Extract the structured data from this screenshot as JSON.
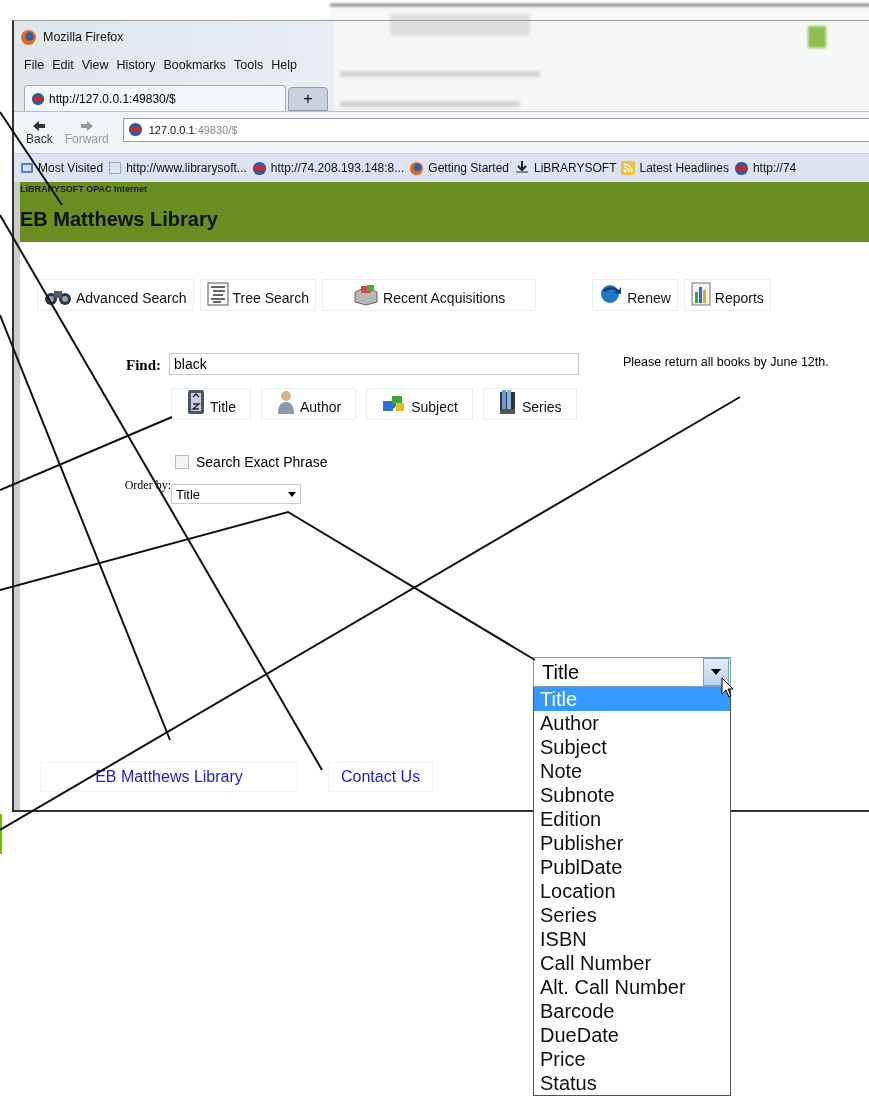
{
  "window": {
    "title": "Mozilla Firefox"
  },
  "menu_bar": [
    "File",
    "Edit",
    "View",
    "History",
    "Bookmarks",
    "Tools",
    "Help"
  ],
  "tabs": [
    {
      "label": "http://127.0.0.1:49830/$",
      "selected": true
    }
  ],
  "new_tab": "+",
  "navigation": {
    "back": {
      "label": "Back",
      "disabled": false
    },
    "forward": {
      "label": "Forward",
      "disabled": true
    },
    "address_host": "127.0.0.1",
    "address_rest": ":49830/$"
  },
  "bookmarks": [
    {
      "label": "Most Visited",
      "kind": "folder"
    },
    {
      "label": "http://www.librarysoft...",
      "kind": "page"
    },
    {
      "label": "http://74.208.193.148:8...",
      "kind": "site"
    },
    {
      "label": "Getting Started",
      "kind": "firefox"
    },
    {
      "label": "LiBRARYSOFT",
      "kind": "app"
    },
    {
      "label": "Latest Headlines",
      "kind": "feed"
    },
    {
      "label": "http://74",
      "kind": "site"
    }
  ],
  "page": {
    "brand": "LiBRARYSOFT OPAC Internet",
    "title": "EB Matthews Library",
    "nav_buttons": [
      {
        "label": "Advanced Search",
        "kind": "binoculars"
      },
      {
        "label": "Tree Search",
        "kind": "tree"
      },
      {
        "label": "Recent Acquisitions",
        "kind": "box"
      },
      {
        "label": "Renew",
        "kind": "renew"
      },
      {
        "label": "Reports",
        "kind": "chart"
      }
    ],
    "find": {
      "label": "Find:",
      "value": "black"
    },
    "notice": "Please return all books by June 12th.",
    "search_buttons": [
      {
        "label": "Title",
        "kind": "az"
      },
      {
        "label": "Author",
        "kind": "person"
      },
      {
        "label": "Subject",
        "kind": "puzzle"
      },
      {
        "label": "Series",
        "kind": "books"
      }
    ],
    "exact_phrase": {
      "label": "Search Exact Phrase",
      "checked": false
    },
    "order_by": {
      "label": "Order by:",
      "value": "Title"
    },
    "footer_links": [
      "EB Matthews Library",
      "Contact Us"
    ]
  },
  "order_dropdown": {
    "value": "Title",
    "options": [
      {
        "label": "Title",
        "selected": true
      },
      {
        "label": "Author",
        "selected": false
      },
      {
        "label": "Subject",
        "selected": false
      },
      {
        "label": "Note",
        "selected": false
      },
      {
        "label": "Subnote",
        "selected": false
      },
      {
        "label": "Edition",
        "selected": false
      },
      {
        "label": "Publisher",
        "selected": false
      },
      {
        "label": "PublDate",
        "selected": false
      },
      {
        "label": "Location",
        "selected": false
      },
      {
        "label": "Series",
        "selected": false
      },
      {
        "label": "ISBN",
        "selected": false
      },
      {
        "label": "Call Number",
        "selected": false
      },
      {
        "label": "Alt. Call Number",
        "selected": false
      },
      {
        "label": "Barcode",
        "selected": false
      },
      {
        "label": "DueDate",
        "selected": false
      },
      {
        "label": "Price",
        "selected": false
      },
      {
        "label": "Status",
        "selected": false
      }
    ]
  }
}
